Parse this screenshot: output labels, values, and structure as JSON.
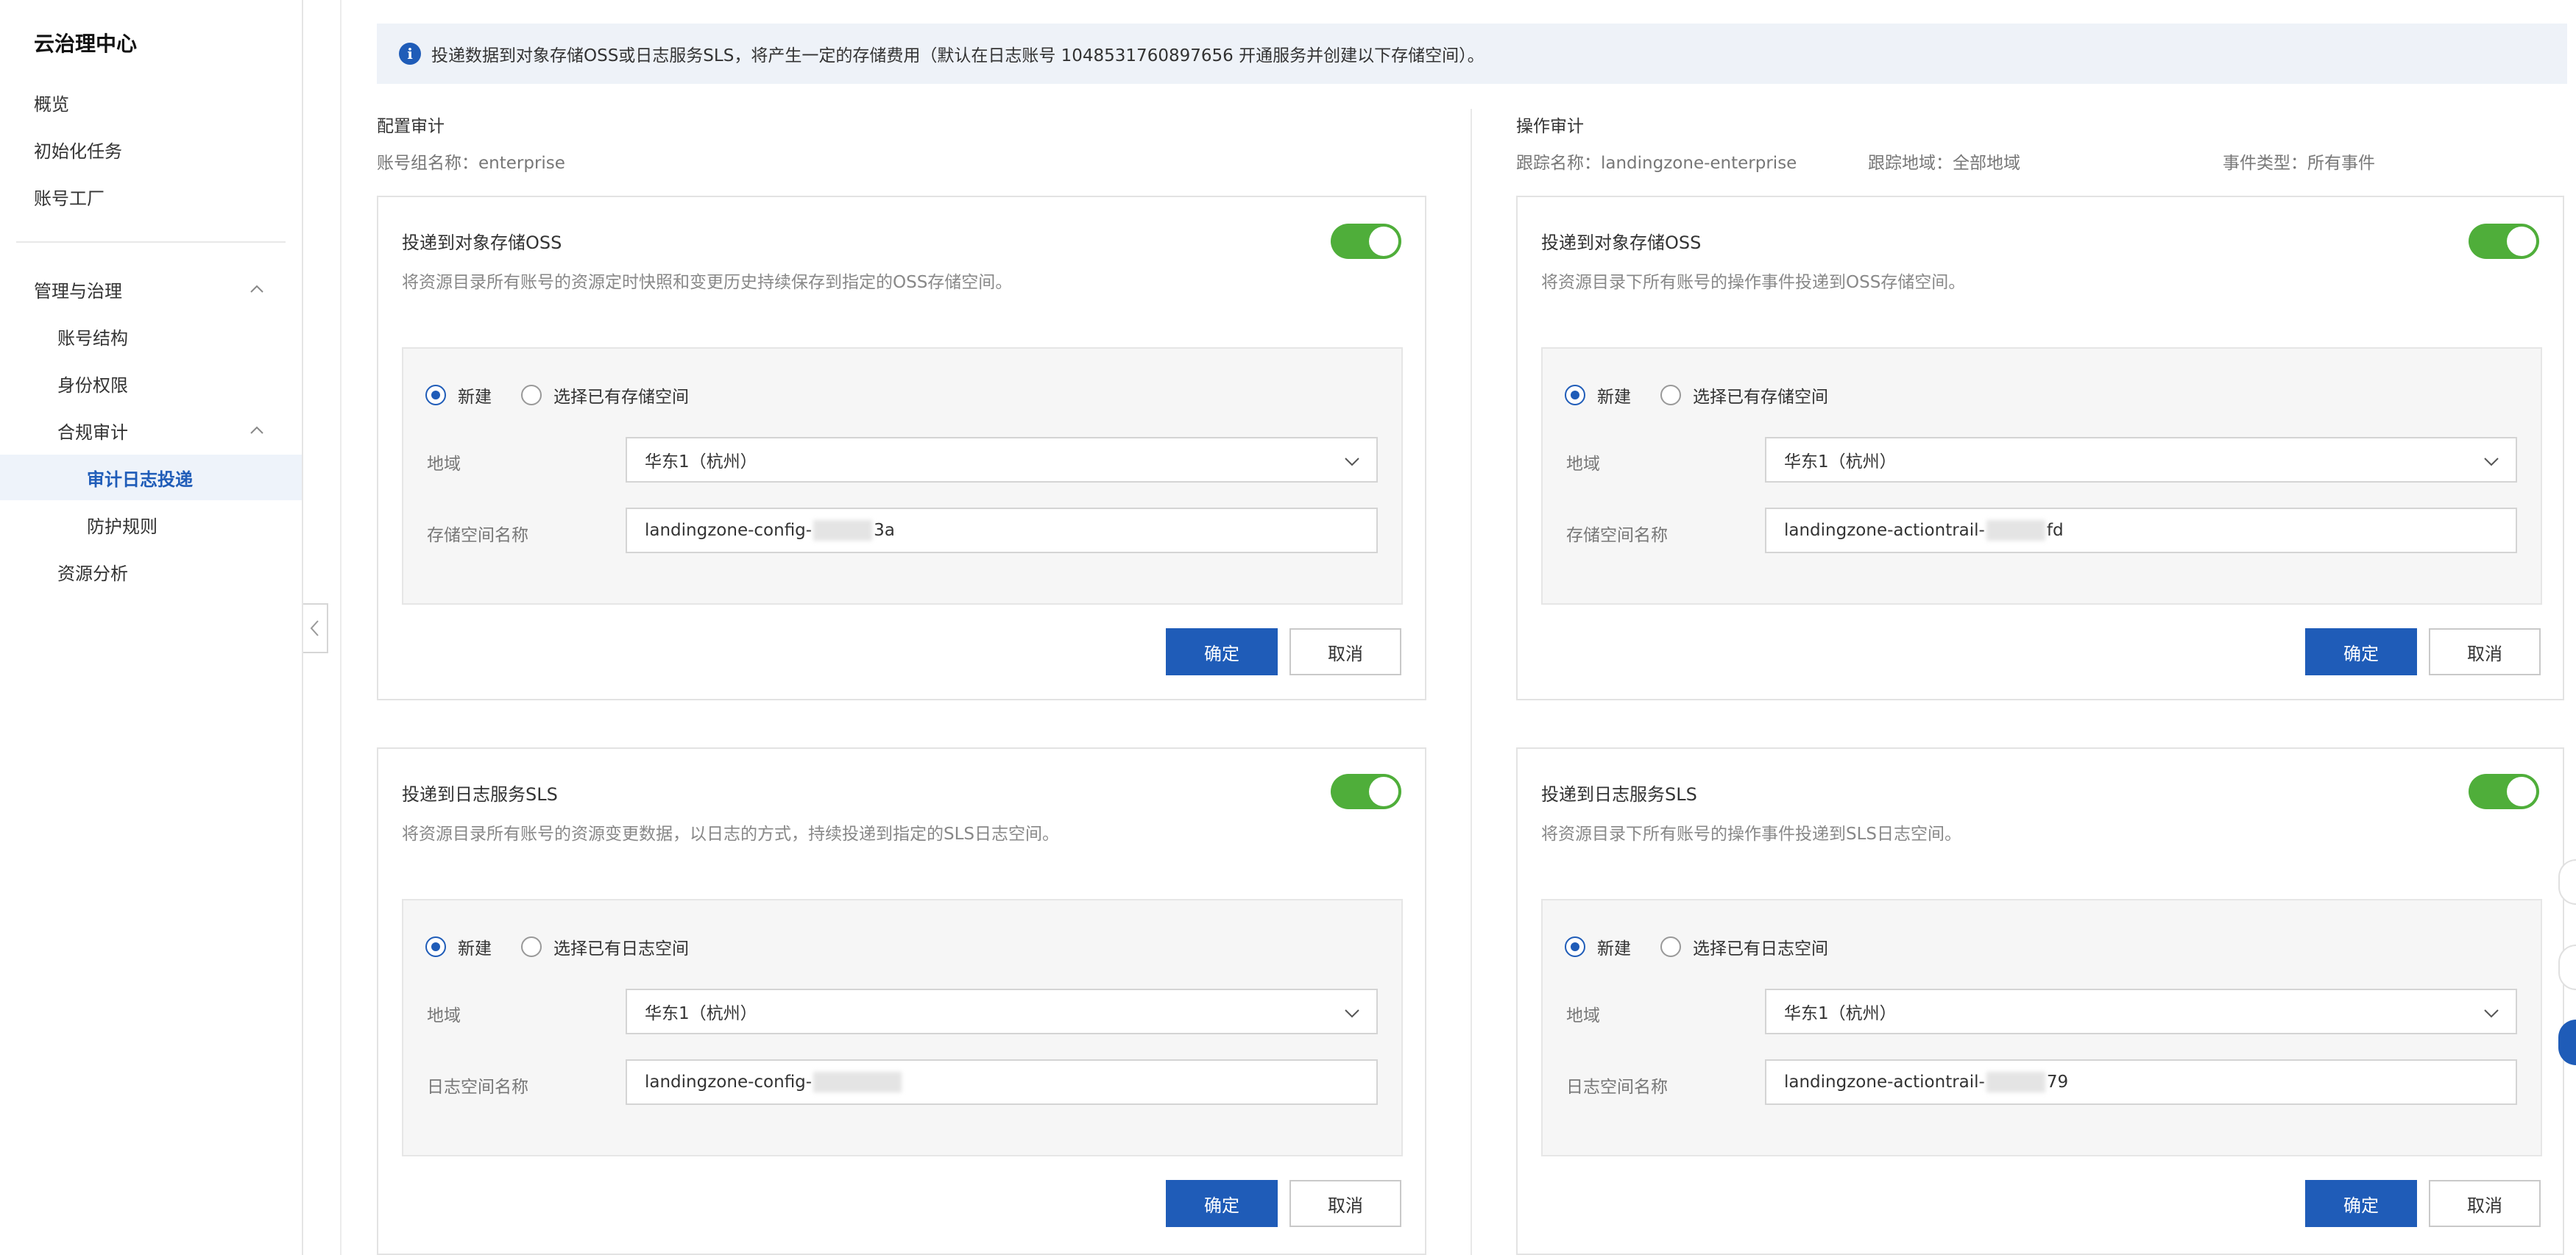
{
  "sidebar": {
    "title": "云治理中心",
    "items": [
      {
        "label": "概览"
      },
      {
        "label": "初始化任务"
      },
      {
        "label": "账号工厂"
      },
      {
        "label": "管理与治理"
      },
      {
        "label": "账号结构"
      },
      {
        "label": "身份权限"
      },
      {
        "label": "合规审计"
      },
      {
        "label": "审计日志投递"
      },
      {
        "label": "防护规则"
      },
      {
        "label": "资源分析"
      }
    ],
    "active_item": "审计日志投递"
  },
  "notice": {
    "icon": "info-icon",
    "text": "投递数据到对象存储OSS或日志服务SLS，将产生一定的存储费用（默认在日志账号 1048531760897656 开通服务并创建以下存储空间）。"
  },
  "config_audit": {
    "title": "配置审计",
    "account_group": "账号组名称：enterprise",
    "oss": {
      "title": "投递到对象存储OSS",
      "desc": "将资源目录所有账号的资源定时快照和变更历史持续保存到指定的OSS存储空间。",
      "enabled": true,
      "radio_new": "新建",
      "radio_existing": "选择已有存储空间",
      "region_label": "地域",
      "region_value": "华东1（杭州）",
      "name_label": "存储空间名称",
      "name_prefix": "landingzone-config-",
      "name_suffix": "3a",
      "confirm": "确定",
      "cancel": "取消"
    },
    "sls": {
      "title": "投递到日志服务SLS",
      "desc": "将资源目录所有账号的资源变更数据，以日志的方式，持续投递到指定的SLS日志空间。",
      "enabled": true,
      "radio_new": "新建",
      "radio_existing": "选择已有日志空间",
      "region_label": "地域",
      "region_value": "华东1（杭州）",
      "name_label": "日志空间名称",
      "name_prefix": "landingzone-config-",
      "name_suffix": "",
      "confirm": "确定",
      "cancel": "取消"
    }
  },
  "action_audit": {
    "title": "操作审计",
    "trail_name": "跟踪名称：landingzone-enterprise",
    "trail_region": "跟踪地域：全部地域",
    "event_type": "事件类型：所有事件",
    "oss": {
      "title": "投递到对象存储OSS",
      "desc": "将资源目录下所有账号的操作事件投递到OSS存储空间。",
      "enabled": true,
      "radio_new": "新建",
      "radio_existing": "选择已有存储空间",
      "region_label": "地域",
      "region_value": "华东1（杭州）",
      "name_label": "存储空间名称",
      "name_prefix": "landingzone-actiontrail-",
      "name_suffix": "fd",
      "confirm": "确定",
      "cancel": "取消"
    },
    "sls": {
      "title": "投递到日志服务SLS",
      "desc": "将资源目录下所有账号的操作事件投递到SLS日志空间。",
      "enabled": true,
      "radio_new": "新建",
      "radio_existing": "选择已有日志空间",
      "region_label": "地域",
      "region_value": "华东1（杭州）",
      "name_label": "日志空间名称",
      "name_prefix": "landingzone-actiontrail-",
      "name_suffix": "79",
      "confirm": "确定",
      "cancel": "取消"
    }
  },
  "colors": {
    "primary": "#1f5cb8",
    "toggle_on": "#4fae3a",
    "notice_bg": "#eef2f8"
  }
}
